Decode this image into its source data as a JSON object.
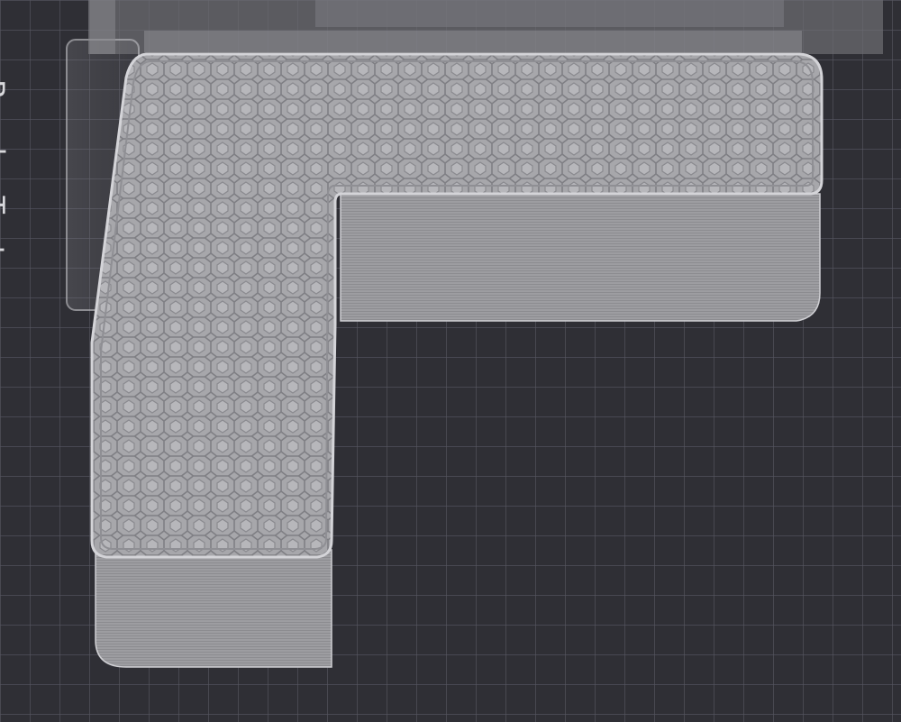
{
  "viewport": {
    "background": "#2f2f35",
    "grid_line_color": "#565661",
    "grid_major_color": "#6a6a75"
  },
  "build_plate": {
    "label": "Bambu Text"
  },
  "model": {
    "shape": "L-shaped block",
    "infill_pattern": "honeycomb",
    "top_color": "#a9a9ad",
    "wall_color": "#9a9a9e",
    "edge_color": "#d0d0d4"
  },
  "icons": [
    "build-plate-icon",
    "model-icon"
  ]
}
